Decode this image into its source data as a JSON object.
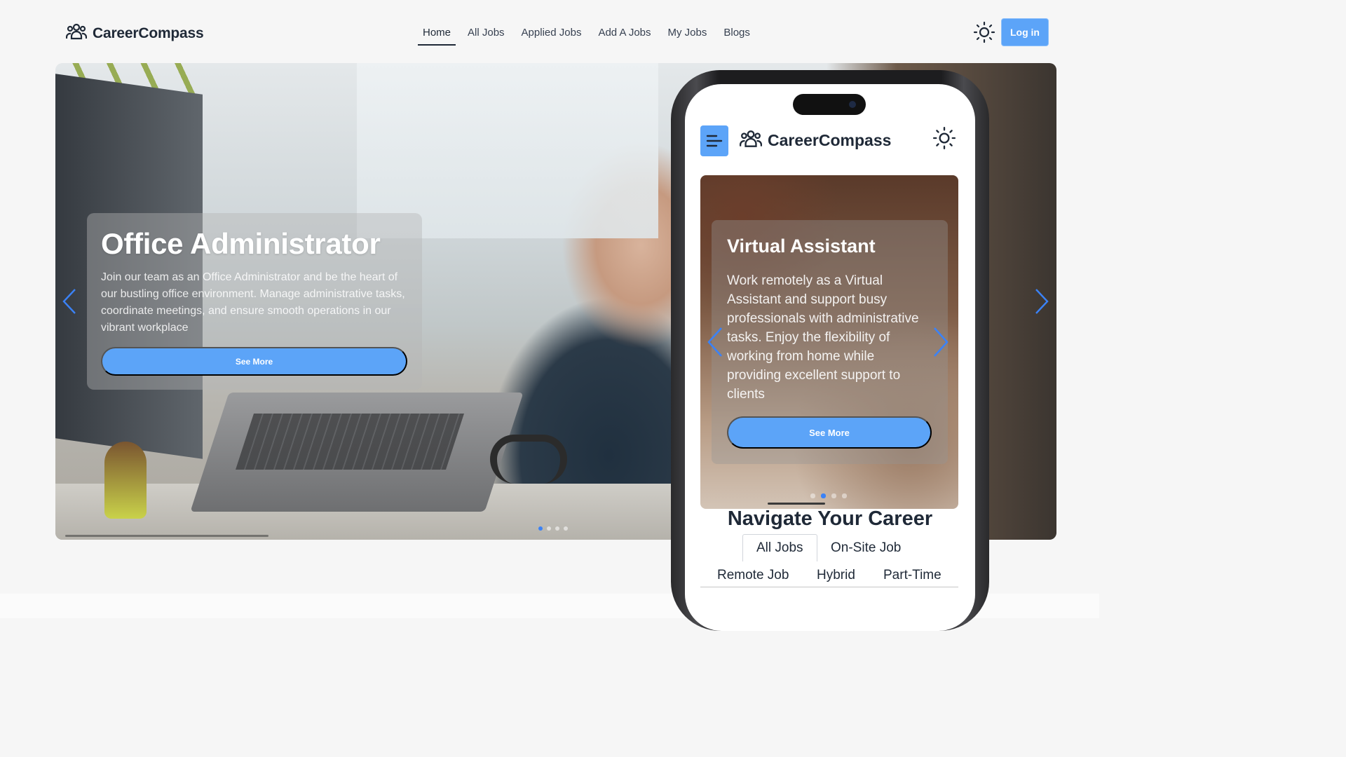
{
  "brand": {
    "name": "CareerCompass",
    "icon": "users-group-icon"
  },
  "nav": {
    "items": [
      {
        "label": "Home",
        "active": true
      },
      {
        "label": "All Jobs"
      },
      {
        "label": "Applied Jobs"
      },
      {
        "label": "Add A Jobs"
      },
      {
        "label": "My Jobs"
      },
      {
        "label": "Blogs"
      }
    ]
  },
  "header": {
    "theme_icon": "sun-icon",
    "login_label": "Log in"
  },
  "hero": {
    "title": "Office Administrator",
    "description": "Join our team as an Office Administrator and be the heart of our bustling office environment. Manage administrative tasks, coordinate meetings, and ensure smooth operations in our vibrant workplace",
    "button_label": "See More",
    "slide_count": 4,
    "active_slide": 1
  },
  "phone": {
    "brand": "CareerCompass",
    "menu_icon": "hamburger-icon",
    "theme_icon": "sun-icon",
    "slide": {
      "title": "Virtual Assistant",
      "description": "Work remotely as a Virtual Assistant and support busy professionals with administrative tasks. Enjoy the flexibility of working from home while providing excellent support to clients",
      "button_label": "See More",
      "slide_count": 4,
      "active_slide": 2
    },
    "section_heading": "Navigate Your Career",
    "tabs": [
      {
        "label": "All Jobs",
        "active": true
      },
      {
        "label": "On-Site Job"
      },
      {
        "label": "Remote Job"
      },
      {
        "label": "Hybrid"
      },
      {
        "label": "Part-Time"
      }
    ]
  },
  "colors": {
    "accent": "#5ca4f8",
    "active_dot": "#3b82f6",
    "text": "#1f2937"
  }
}
